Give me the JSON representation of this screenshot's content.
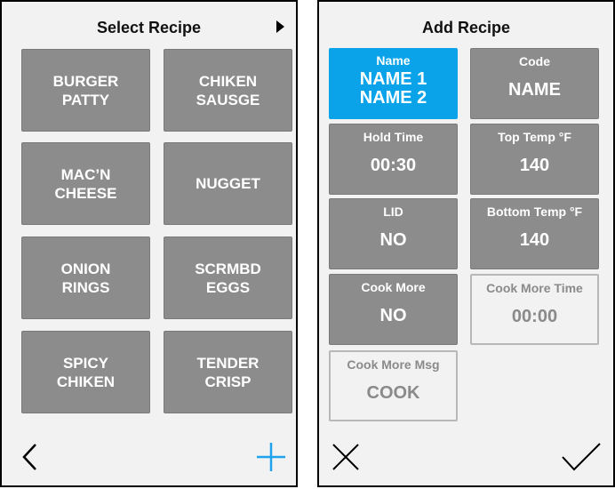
{
  "left": {
    "title": "Select Recipe",
    "next_icon": "play-triangle-icon",
    "recipes": [
      {
        "label": "BURGER\nPATTY"
      },
      {
        "label": "CHIKEN\nSAUSGE"
      },
      {
        "label": "MAC’N\nCHEESE"
      },
      {
        "label": "NUGGET"
      },
      {
        "label": "ONION\nRINGS"
      },
      {
        "label": "SCRMBD\nEGGS"
      },
      {
        "label": "SPICY\nCHIKEN"
      },
      {
        "label": "TENDER\nCRISP"
      }
    ],
    "back_icon": "chevron-left-icon",
    "add_icon": "plus-icon",
    "add_color": "#1fa3ee"
  },
  "right": {
    "title": "Add Recipe",
    "fields": {
      "name": {
        "label": "Name",
        "value_line1": "NAME 1",
        "value_line2": "NAME 2"
      },
      "code": {
        "label": "Code",
        "value": "NAME"
      },
      "hold_time": {
        "label": "Hold Time",
        "value": "00:30"
      },
      "top_temp": {
        "label": "Top Temp °F",
        "value": "140"
      },
      "lid": {
        "label": "LID",
        "value": "NO"
      },
      "bottom_temp": {
        "label": "Bottom Temp °F",
        "value": "140"
      },
      "cook_more": {
        "label": "Cook More",
        "value": "NO"
      },
      "cook_more_time": {
        "label": "Cook More Time",
        "value": "00:00"
      },
      "cook_more_msg": {
        "label": "Cook More Msg",
        "value": "COOK"
      }
    },
    "cancel_icon": "close-x-icon",
    "confirm_icon": "checkmark-icon"
  },
  "colors": {
    "tile_gray": "#8c8c8c",
    "selected_blue": "#0aa3ea",
    "background": "#f2f2f2"
  }
}
